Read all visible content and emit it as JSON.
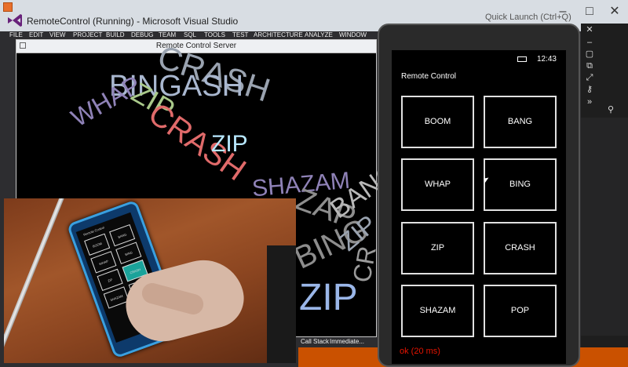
{
  "vs": {
    "title": "RemoteControl (Running) - Microsoft Visual Studio",
    "quick_launch": "Quick Launch (Ctrl+Q)",
    "menu": [
      "FILE",
      "EDIT",
      "VIEW",
      "PROJECT",
      "BUILD",
      "DEBUG",
      "TEAM",
      "SQL",
      "TOOLS",
      "TEST",
      "ARCHITECTURE",
      "ANALYZE",
      "WINDOW"
    ],
    "bottom_tabs": [
      "Call Stack",
      "Immediate..."
    ],
    "accent_color": "#ca5100"
  },
  "server": {
    "title": "Remote Control Server",
    "words": [
      "CRASH",
      "BINGASH",
      "WHAP",
      "ZIP",
      "CRASH",
      "ZIP",
      "SHAZAM",
      "ZAP",
      "BING",
      "ZIP",
      "BANG",
      "CR",
      "ZIP"
    ]
  },
  "phone": {
    "time": "12:43",
    "app_title": "Remote Control",
    "buttons": [
      "BOOM",
      "BANG",
      "WHAP",
      "BING",
      "ZIP",
      "CRASH",
      "SHAZAM",
      "POP"
    ],
    "status": "ok (20 ms)",
    "status_color": "#e51400"
  }
}
